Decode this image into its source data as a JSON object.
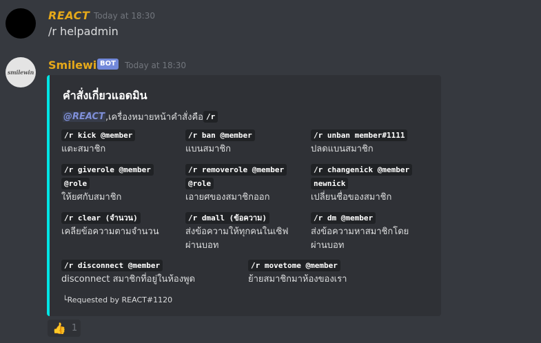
{
  "messages": [
    {
      "author": "REACT",
      "timestamp": "Today at 18:30",
      "content": "/r helpadmin"
    },
    {
      "author": "Smilewin",
      "avatar_text": "smilewin",
      "badge": "BOT",
      "timestamp": "Today at 18:30",
      "embed": {
        "accent_color": "#00e5e5",
        "title": "คำสั่งเกี่ยวแอดมิน",
        "mention": "@REACT",
        "desc_text": " ,เครื่องหมายหน้าคำสั่งคือ ",
        "desc_code": "/r",
        "fields": [
          {
            "name": "/r kick @member",
            "value": "แตะสมาชิก"
          },
          {
            "name": "/r ban @member",
            "value": "แบนสมาชิก"
          },
          {
            "name": "/r unban member#1111",
            "value": "ปลดแบนสมาชิก"
          },
          {
            "name": "/r giverole @member",
            "name2": "@role",
            "value": "ให้ยศกับสมาชิก"
          },
          {
            "name": "/r removerole @member",
            "name2": "@role",
            "value": "เอายศของสมาชิกออก"
          },
          {
            "name": "/r changenick @member",
            "name2": "newnick",
            "value": "เปลี่ยนชื่อของสมาชิก"
          },
          {
            "name": "/r clear (จำนวน)",
            "value": "เคลียข้อความตามจำนวน"
          },
          {
            "name": "/r dmall (ข้อความ)",
            "value": "ส่งข้อความให้ทุกคนในเซิฟ",
            "value2": "ผ่านบอท"
          },
          {
            "name": "/r dm @member",
            "value": "ส่งข้อความหาสมาชิกโดย",
            "value2": "ผ่านบอท"
          },
          {
            "name": "/r disconnect @member",
            "value": "disconnect สมาชิกที่อยู่ในห้องพูด"
          },
          {
            "name": "/r movetome @member",
            "value": "ย้ายสมาชิกมาห้องของเรา"
          }
        ],
        "footer": "└Requested by REACT#1120"
      },
      "reaction": {
        "emoji": "thumbs-up",
        "glyph": "👍",
        "count": "1"
      }
    }
  ]
}
